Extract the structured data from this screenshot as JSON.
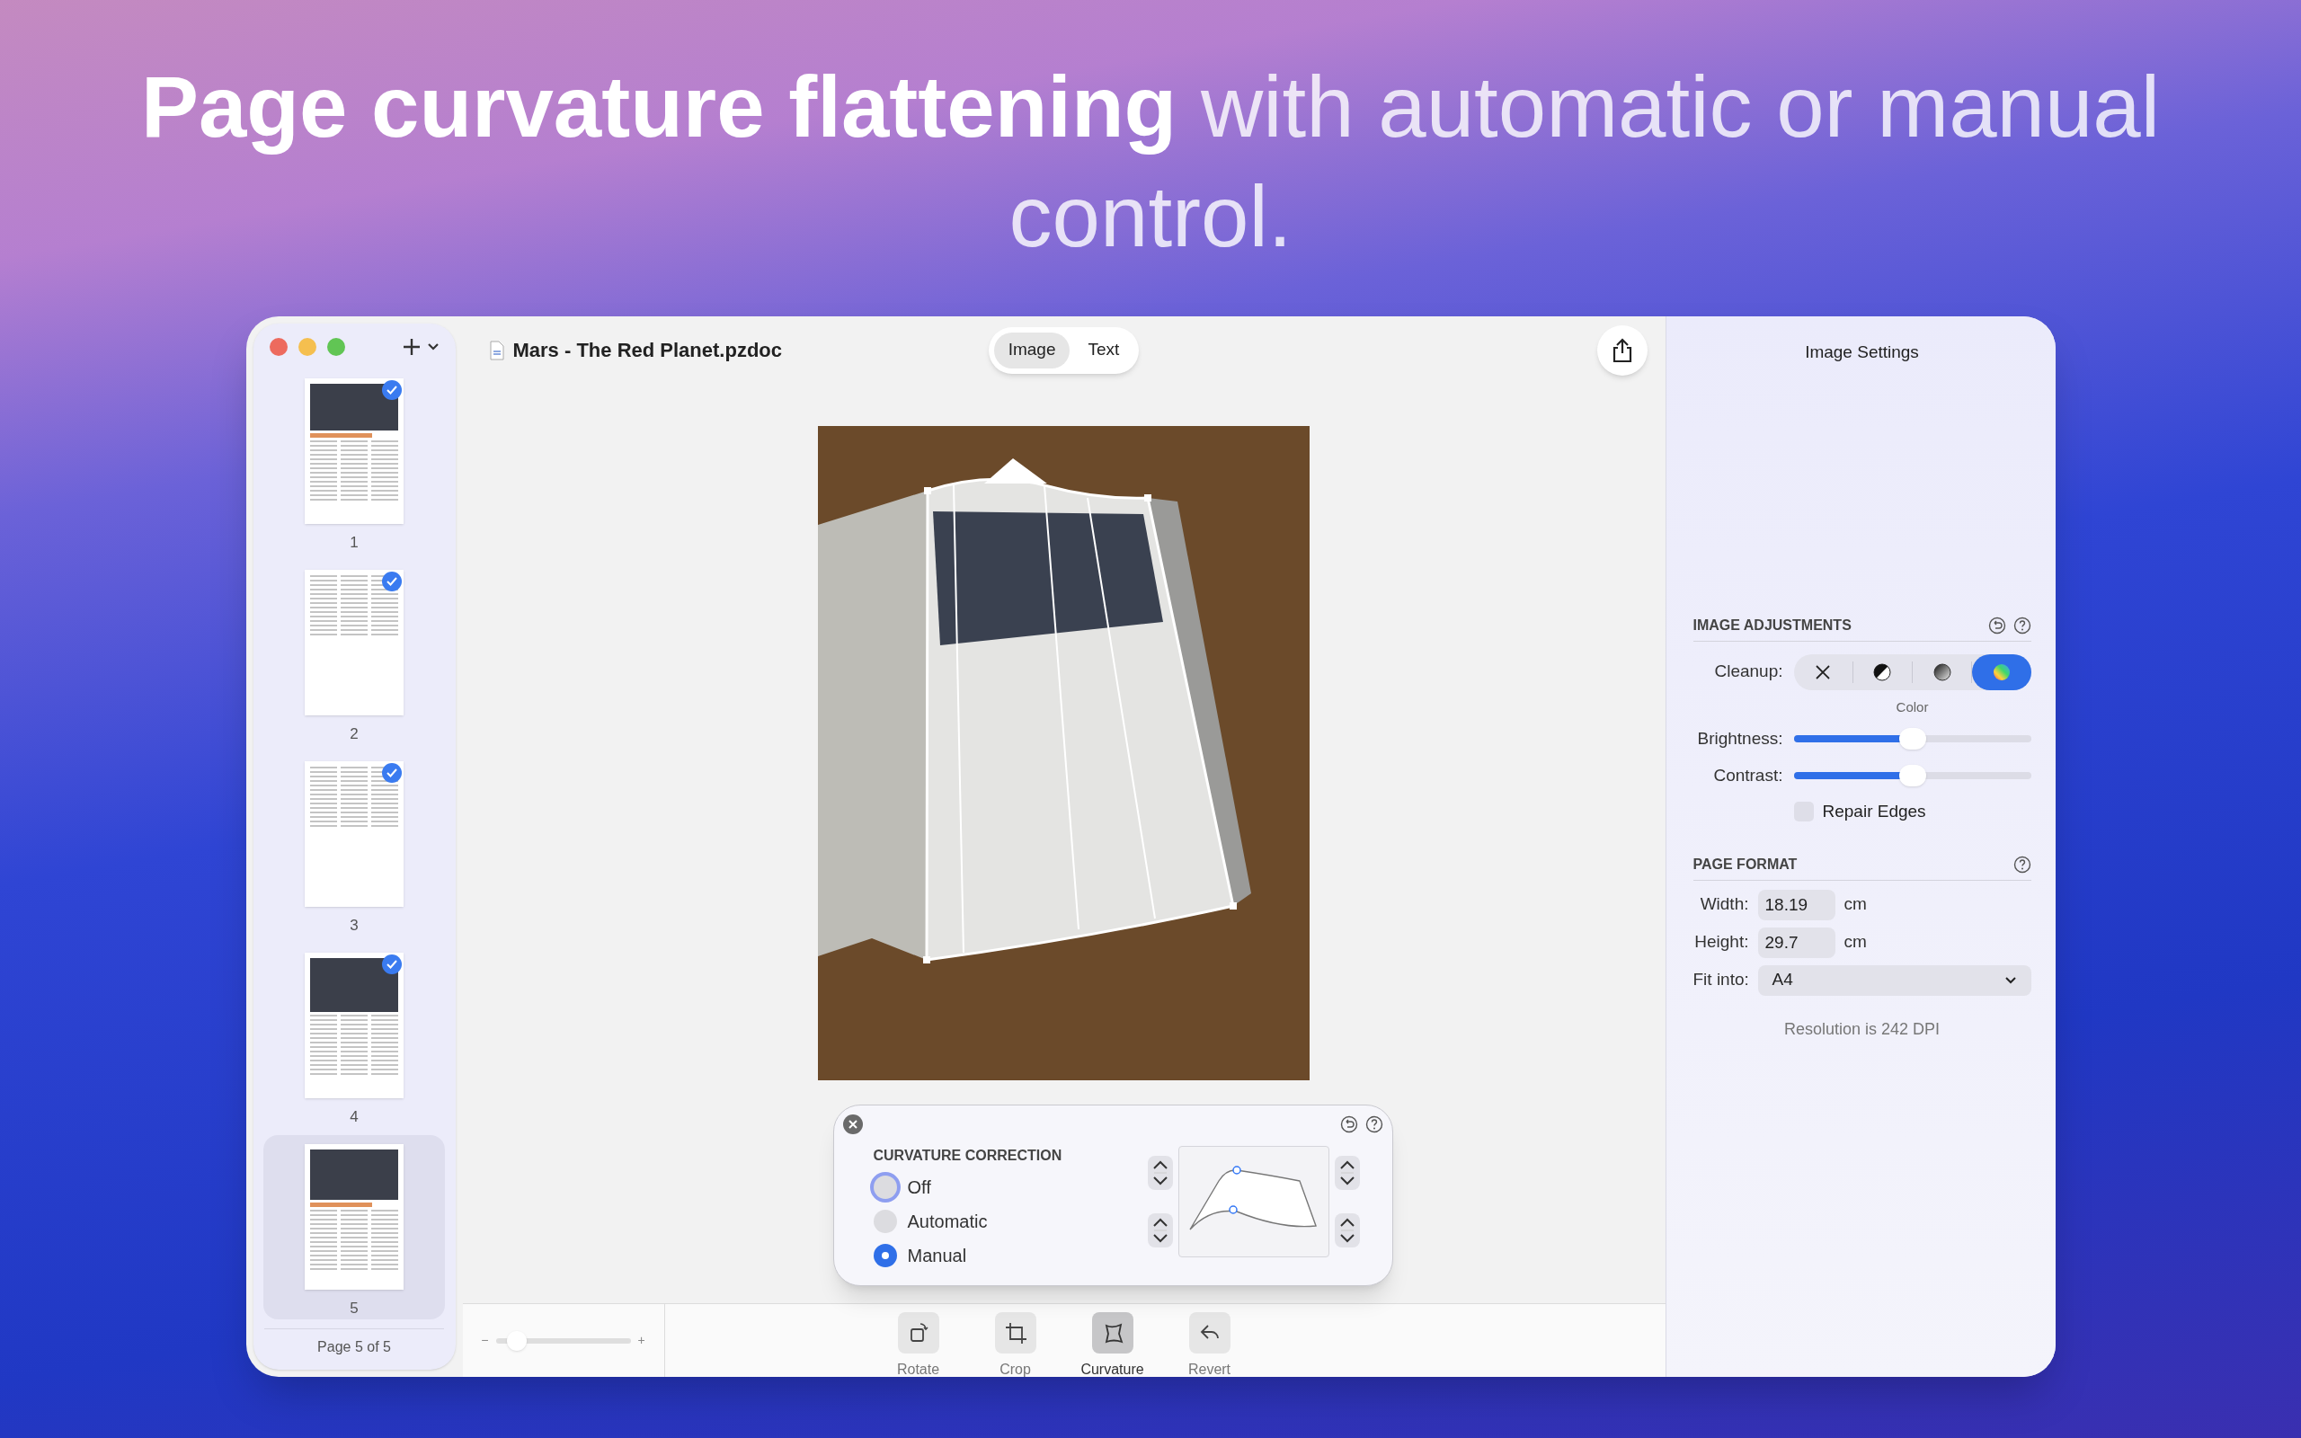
{
  "headline": "**Page curvature flattening** with automatic or manual control.",
  "sidebar": {
    "pages": [
      {
        "label": "1",
        "checked": true,
        "selected": false
      },
      {
        "label": "2",
        "checked": true,
        "selected": false
      },
      {
        "label": "3",
        "checked": true,
        "selected": false
      },
      {
        "label": "4",
        "checked": true,
        "selected": false
      },
      {
        "label": "5",
        "checked": false,
        "selected": true
      }
    ],
    "footer": "Page 5 of 5"
  },
  "toolbar": {
    "document_title": "Mars - The Red Planet.pzdoc",
    "mode_tabs": [
      {
        "label": "Image",
        "selected": true
      },
      {
        "label": "Text",
        "selected": false
      }
    ]
  },
  "curvature_popup": {
    "title": "CURVATURE CORRECTION",
    "options": [
      {
        "label": "Off",
        "selected": false,
        "focused": true
      },
      {
        "label": "Automatic",
        "selected": false,
        "focused": false
      },
      {
        "label": "Manual",
        "selected": true,
        "focused": false
      }
    ]
  },
  "zoom": {
    "minus": "−",
    "plus": "+",
    "level": 0.1
  },
  "bottom_tools": [
    {
      "kind": "rotate",
      "label": "Rotate",
      "selected": false
    },
    {
      "kind": "crop",
      "label": "Crop",
      "selected": false
    },
    {
      "kind": "curvature",
      "label": "Curvature",
      "selected": true
    },
    {
      "kind": "revert",
      "label": "Revert",
      "selected": false
    }
  ],
  "settings": {
    "title": "Image Settings",
    "image_adjustments": {
      "heading": "IMAGE ADJUSTMENTS",
      "cleanup_label": "Cleanup:",
      "cleanup_options": [
        {
          "kind": "none",
          "selected": false
        },
        {
          "kind": "bw",
          "selected": false
        },
        {
          "kind": "grayscale",
          "selected": false
        },
        {
          "kind": "color",
          "selected": true
        }
      ],
      "cleanup_caption": "Color",
      "sliders": [
        {
          "label": "Brightness:",
          "level": 0.5
        },
        {
          "label": "Contrast:",
          "level": 0.5
        }
      ],
      "repair_edges": {
        "label": "Repair Edges",
        "checked": false
      }
    },
    "page_format": {
      "heading": "PAGE FORMAT",
      "width": {
        "label": "Width:",
        "value": "18.19",
        "unit": "cm"
      },
      "height": {
        "label": "Height:",
        "value": "29.7",
        "unit": "cm"
      },
      "fit_into": {
        "label": "Fit into:",
        "value": "A4"
      },
      "resolution": "Resolution is 242 DPI"
    }
  }
}
